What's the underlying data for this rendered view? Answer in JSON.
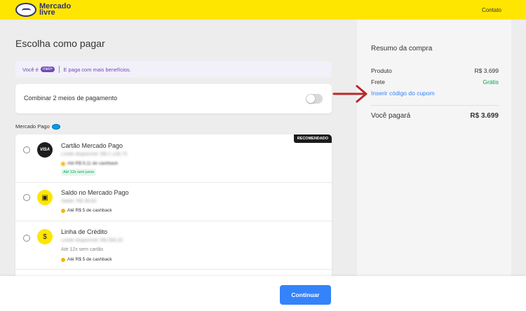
{
  "header": {
    "logo_text_1": "Mercado",
    "logo_text_2": "livre",
    "contact": "Contato"
  },
  "main": {
    "title": "Escolha como pagar",
    "meli_banner": {
      "prefix": "Você é",
      "pill": "meli+",
      "text": "E paga com mais benefícios."
    },
    "combine_label": "Combinar 2 meios de pagamento",
    "section_label": "Mercado Pago",
    "recommended": "RECOMENDADO",
    "methods": [
      {
        "title": "Cartão Mercado Pago",
        "icon_text": "VISA",
        "line1": "Limite disponível: R$ 2.128,73",
        "cashback": "Até R$ 9,11 de cashback",
        "pill": "Até 12x sem juros"
      },
      {
        "title": "Saldo no Mercado Pago",
        "icon": "wallet-icon",
        "line1": "Saldo: R$ 38,63",
        "cashback": "Até R$ 5 de cashback"
      },
      {
        "title": "Linha de Crédito",
        "icon": "dollar-coin-icon",
        "line1": "Limite disponível: R$ 350,32",
        "line2": "Até 12x sem cartão",
        "cashback": "Até R$ 5 de cashback"
      }
    ]
  },
  "summary": {
    "title": "Resumo da compra",
    "product_label": "Produto",
    "product_value": "R$ 3.699",
    "shipping_label": "Frete",
    "shipping_value": "Grátis",
    "coupon": "Inserir código do cupom",
    "total_label": "Você pagará",
    "total_value": "R$ 3.699"
  },
  "footer": {
    "continue": "Continuar"
  },
  "colors": {
    "header": "#ffe600",
    "primary_blue": "#3483fa",
    "meli_purple": "#6f4ab7",
    "free_green": "#00a650",
    "arrow_red": "#b72a2a"
  }
}
